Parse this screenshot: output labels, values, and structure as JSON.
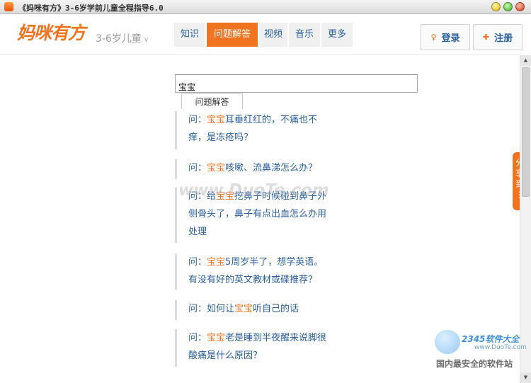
{
  "window": {
    "title": "《妈咪有方》3-6岁学前儿童全程指导6.0"
  },
  "header": {
    "logo": "妈咪有方",
    "age_selector": "3-6岁儿童",
    "nav": [
      "知识",
      "问题解答",
      "视频",
      "音乐",
      "更多"
    ],
    "active_nav": "问题解答",
    "login_label": "登录",
    "register_label": "注册"
  },
  "search": {
    "value": "宝宝",
    "dropdown_tab": "问题解答"
  },
  "results": [
    {
      "prefix": "问：",
      "highlight": "宝宝",
      "line1": "耳垂红红的，不痛也不",
      "line2": "痒，是冻疮吗？",
      "line3": ""
    },
    {
      "prefix": "问：",
      "highlight": "宝宝",
      "line1": "咳嗽、流鼻涕怎么办？",
      "line2": "",
      "line3": ""
    },
    {
      "prefix": "问：给",
      "highlight": "宝宝",
      "line1": "挖鼻子时候碰到鼻子外",
      "line2": "侧骨头了，鼻子有点出血怎么办用",
      "line3": "处理"
    },
    {
      "prefix": "问：",
      "highlight": "宝宝",
      "line1": "5周岁半了，想学英语。",
      "line2": "有没有好的英文教材或碟推荐？",
      "line3": ""
    },
    {
      "prefix": "问：如何让",
      "highlight": "宝宝",
      "line1": "听自己的话",
      "line2": "",
      "line3": ""
    },
    {
      "prefix": "问：",
      "highlight": "宝宝",
      "line1": "老是睡到半夜醒来说脚很",
      "line2": "酸痛是什么原因？",
      "line3": ""
    }
  ],
  "share_tab": [
    "分",
    "享",
    "到"
  ],
  "watermark": {
    "center": "www.DuoTe.com",
    "brand": "2345软件大全",
    "site": "www.DuoTe.com",
    "slogan": "国内最安全的软件站"
  },
  "colors": {
    "accent": "#f07320",
    "link": "#2a5f9e"
  }
}
